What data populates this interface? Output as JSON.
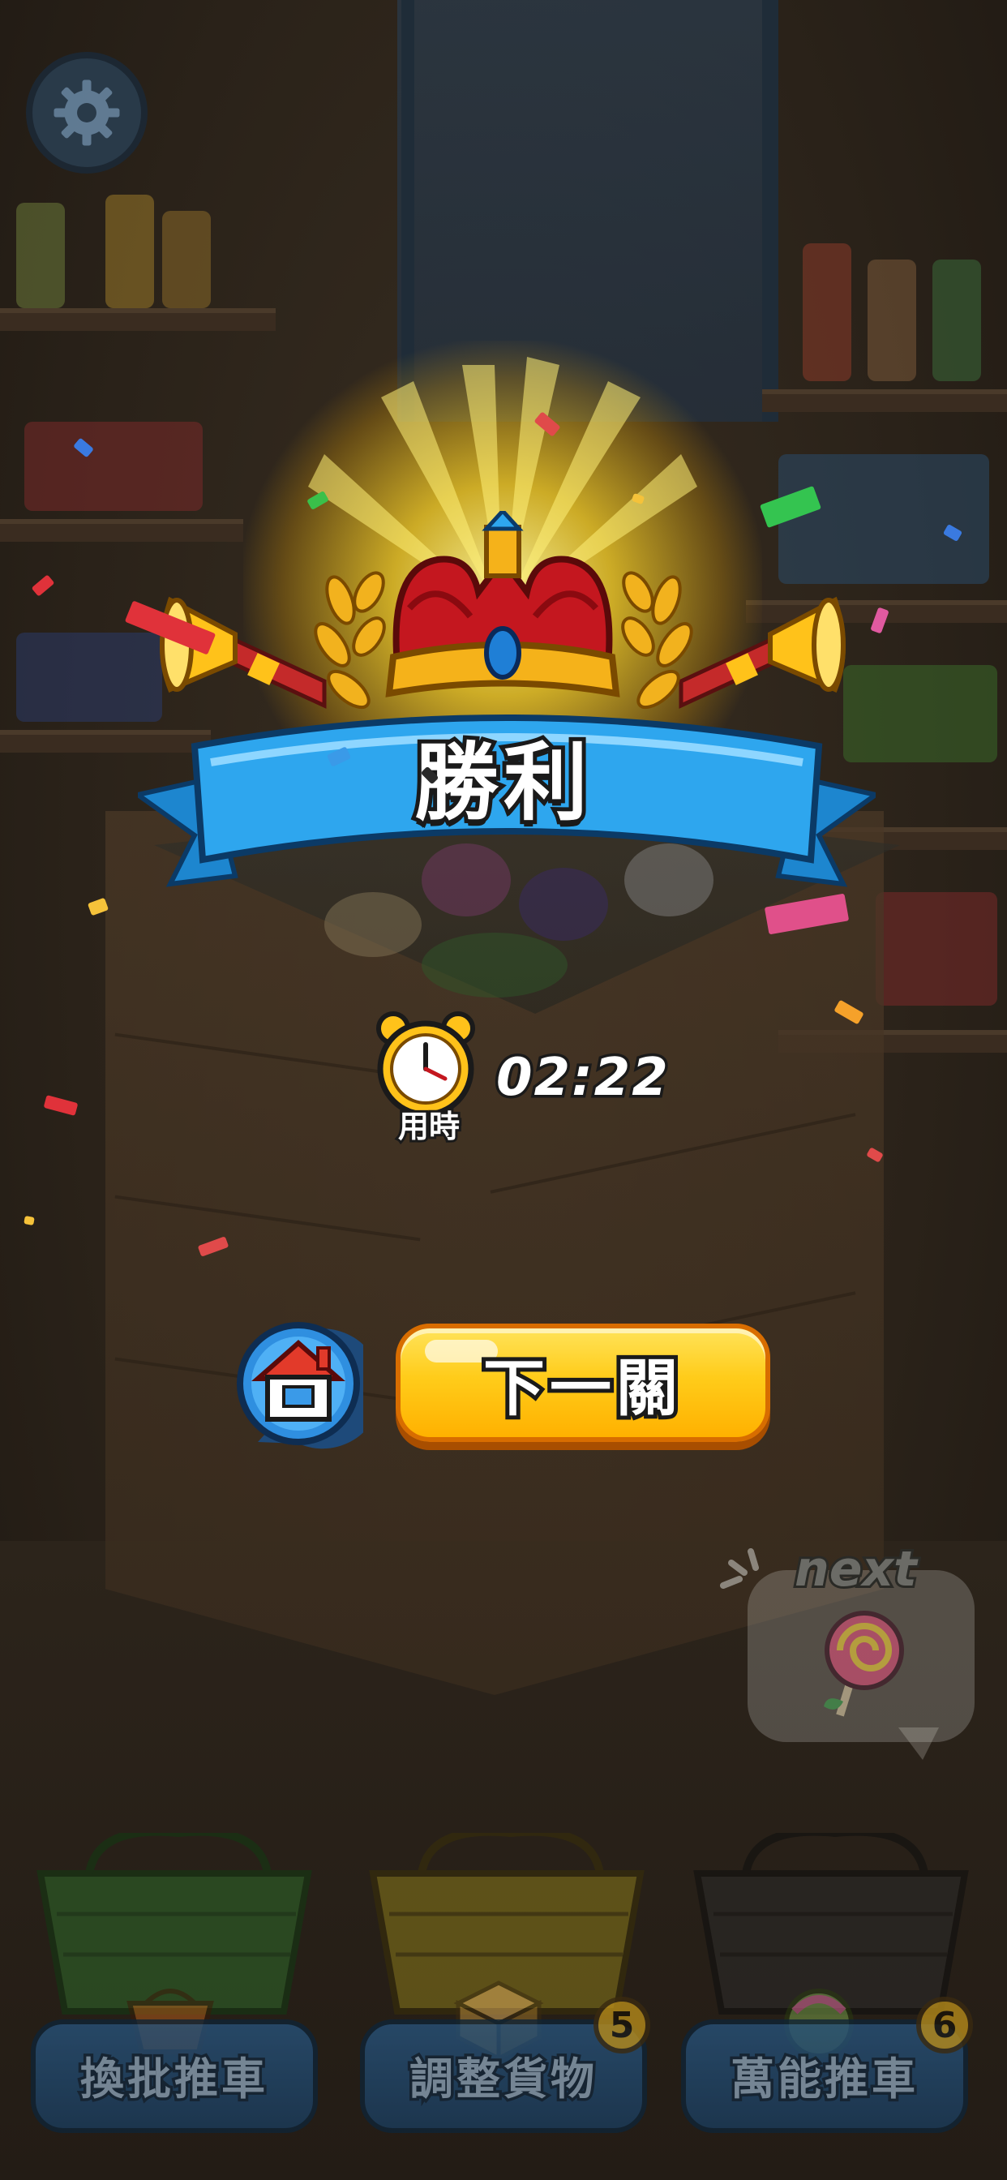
{
  "screen": {
    "title": "勝利",
    "time_label": "用時",
    "time_value": "02:22"
  },
  "actions": {
    "next_level_label": "下一關"
  },
  "next_preview": {
    "label": "next",
    "item_icon": "lollipop-icon"
  },
  "tools": [
    {
      "label": "換批推車",
      "icon": "cart-swap-icon",
      "count": ""
    },
    {
      "label": "調整貨物",
      "icon": "box-shuffle-icon",
      "count": "5"
    },
    {
      "label": "萬能推車",
      "icon": "magic-cart-icon",
      "count": "6"
    }
  ],
  "colors": {
    "ribbon": "#2ea6ee",
    "next_button": "#ffc21a",
    "crown_gold": "#f5b21a",
    "crown_red": "#c4171f"
  }
}
